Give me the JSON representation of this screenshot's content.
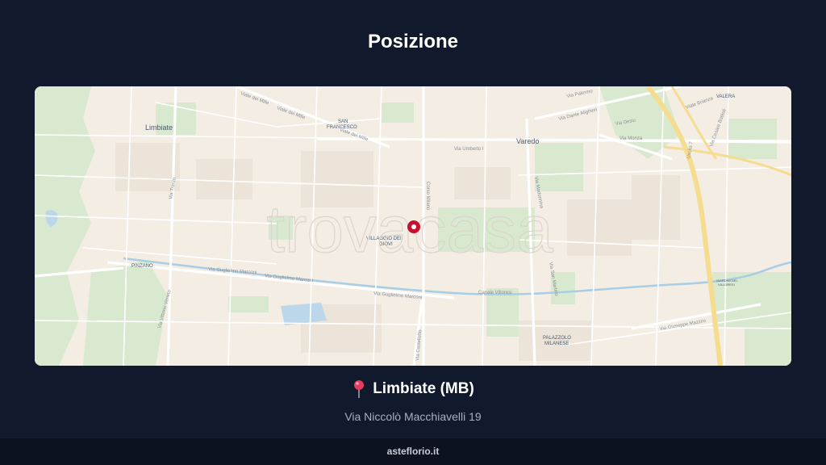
{
  "page": {
    "title": "Posizione"
  },
  "map": {
    "watermark": "trovacasa",
    "labels": {
      "limbiate": "Limbiate",
      "san_francesco_1": "SAN",
      "san_francesco_2": "FRANCESCO",
      "varedo": "Varedo",
      "valera": "VALERA",
      "villaggio_1": "VILLAGGIO DEI",
      "villaggio_2": "GIOVI",
      "pinzano": "PINZANO",
      "palazzolo_1": "PALAZZOLO",
      "palazzolo_2": "MILANESE",
      "giardini_1": "GIARDINI DEL",
      "giardini_2": "VILLORESI"
    },
    "streets": {
      "viale_dei_mille_1": "Viale dei Mille",
      "viale_dei_mille_2": "Viale dei Mille",
      "viale_dei_mille_3": "Viale dei Mille",
      "via_umberto": "Via Umberto I",
      "corso_milano": "Corso Milano",
      "via_marconi_1": "Via Guglielmo Marconi",
      "via_marconi_2": "Via Guglielmo Marconi",
      "via_marconi_3": "Via Guglielmo Marconi",
      "via_castelletto": "Via Castelletto",
      "via_mazzini": "Via Giuseppe Mazzini",
      "via_dante": "Via Dante Alighieri",
      "via_desio": "Via Desio",
      "via_monza": "Via Monza",
      "via_madonnina": "Via Madonnina",
      "via_palermo": "Via Palermo",
      "viale_brianza": "Viale Brianza",
      "canale_villoresi": "Canale Villoresi",
      "via_vittorio_veneto": "Via Vittorio Veneto",
      "via_sanmartino": "Via San Martino",
      "via_trento": "Via Trento",
      "uscita": "Uscita 7",
      "via_battisti": "Via Cesare Battisti"
    }
  },
  "location": {
    "pin_icon": "map-pin-icon",
    "city": "Limbiate (MB)",
    "address": "Via Niccolò Macchiavelli 19"
  },
  "footer": {
    "site": "asteflorio.it"
  },
  "colors": {
    "background": "#111a2c",
    "map_base": "#f3ede4",
    "park": "#d9e9cf",
    "water": "#bcd7ea",
    "highway": "#f5dc8f",
    "marker": "#c8102e"
  }
}
